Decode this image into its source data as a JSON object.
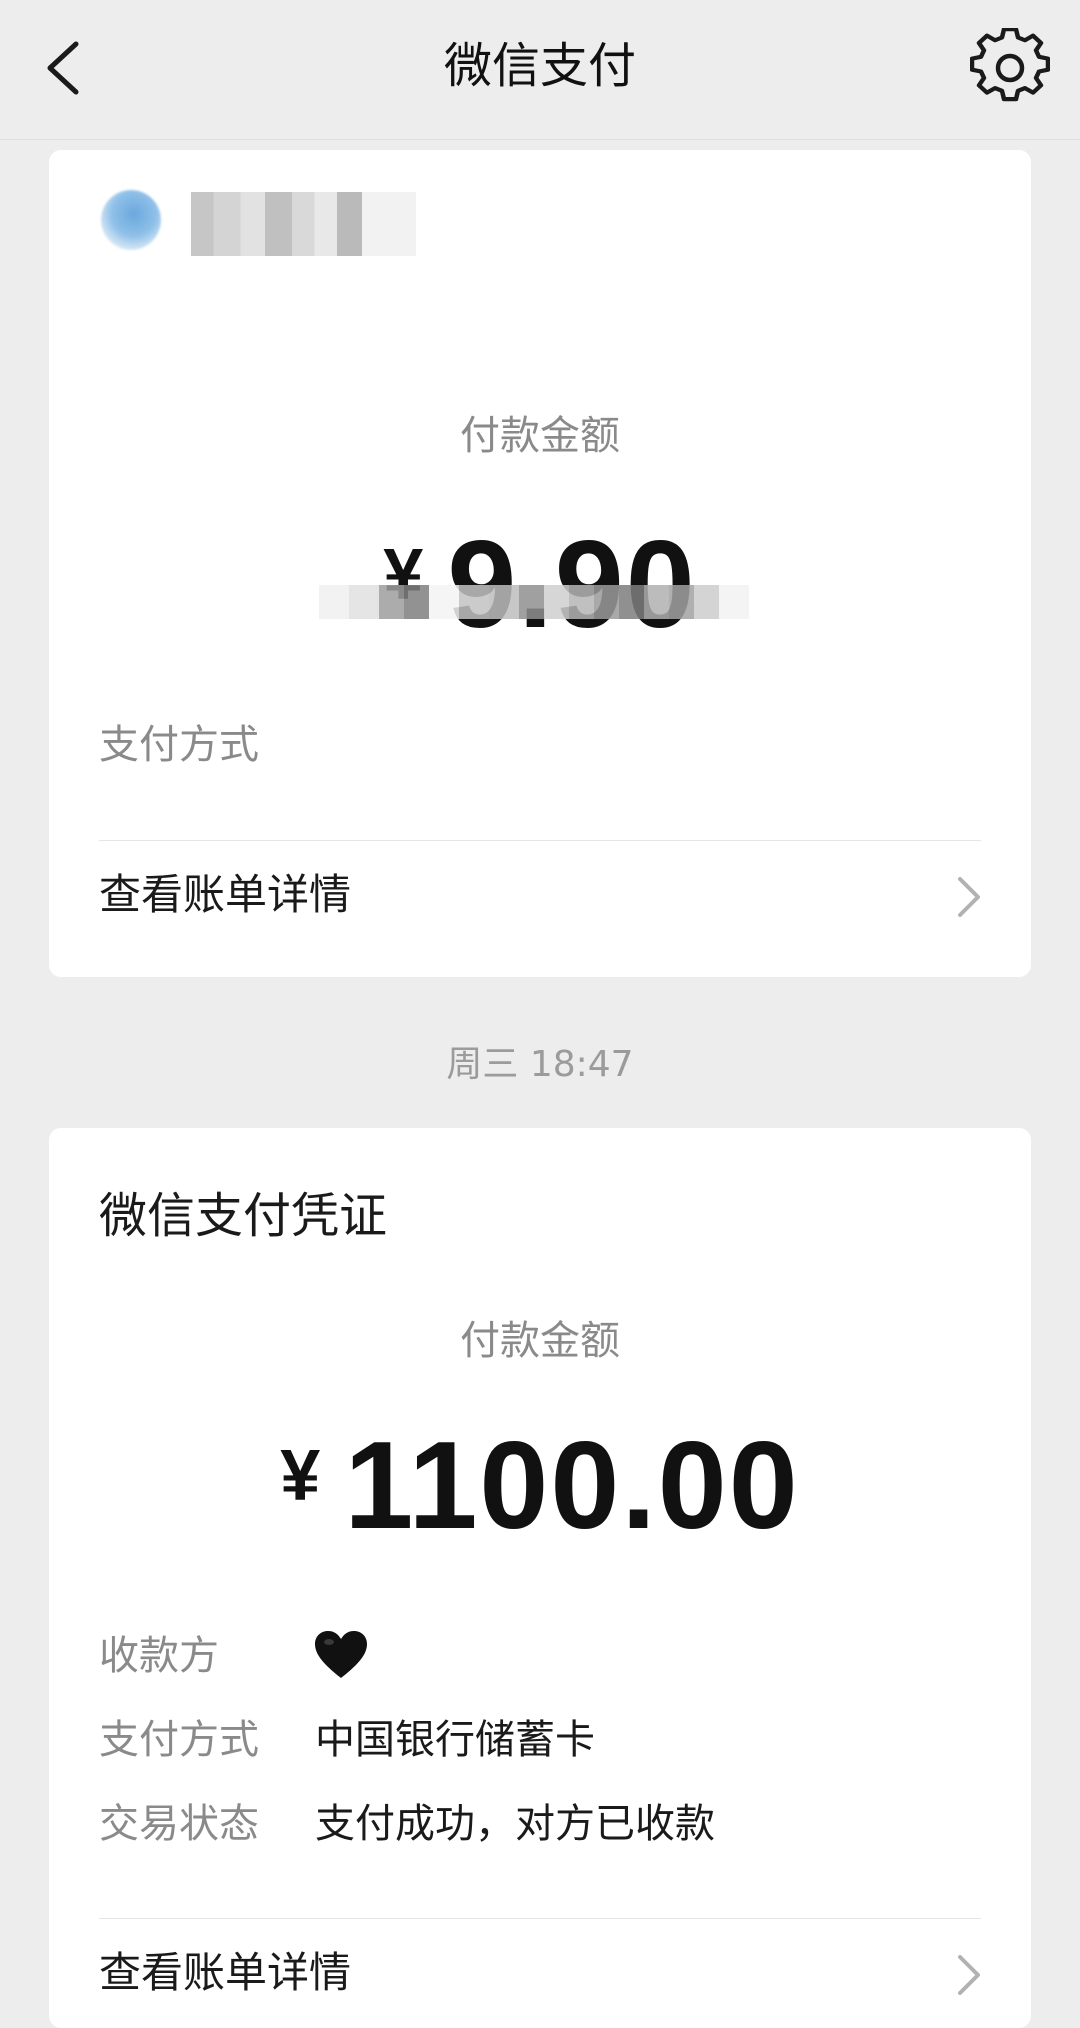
{
  "header": {
    "title": "微信支付"
  },
  "card1": {
    "amount_label": "付款金额",
    "currency": "¥",
    "amount": "9.90",
    "payment_method_label": "支付方式",
    "detail_link": "查看账单详情"
  },
  "timestamp": "周三 18:47",
  "card2": {
    "title": "微信支付凭证",
    "amount_label": "付款金额",
    "currency": "¥",
    "amount": "1100.00",
    "payee_label": "收款方",
    "payment_method_label": "支付方式",
    "payment_method_value": "中国银行储蓄卡",
    "status_label": "交易状态",
    "status_value": "支付成功，对方已收款",
    "detail_link": "查看账单详情"
  },
  "icons": {
    "back": "chevron-left-icon",
    "settings": "gear-icon",
    "payee": "black-heart-icon",
    "detail": "chevron-right-icon"
  },
  "colors": {
    "background": "#ededed",
    "card": "#ffffff",
    "secondary_text": "#8a8a8a",
    "primary_text": "#1a1a1a"
  }
}
